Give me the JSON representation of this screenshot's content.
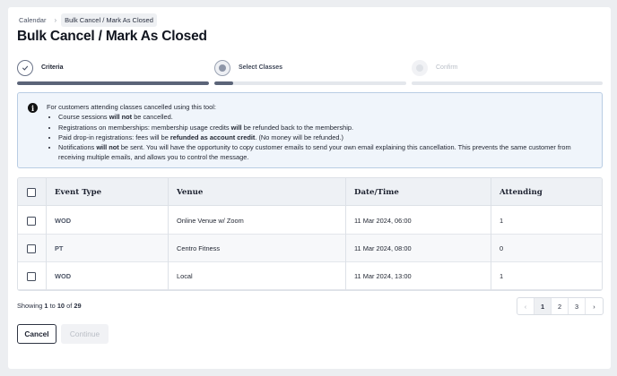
{
  "breadcrumb": {
    "parent": "Calendar",
    "current": "Bulk Cancel / Mark As Closed"
  },
  "page": {
    "title": "Bulk Cancel / Mark As Closed"
  },
  "stepper": {
    "steps": [
      {
        "label": "Criteria",
        "state": "complete"
      },
      {
        "label": "Select Classes",
        "state": "current"
      },
      {
        "label": "Confirm",
        "state": "upcoming"
      }
    ],
    "progress": [
      1.0,
      0.1,
      0.0
    ]
  },
  "info": {
    "icon": "info-icon",
    "intro": "For customers attending classes cancelled using this tool:",
    "b1_a": "Course sessions ",
    "b1_b": "will not",
    "b1_c": " be cancelled.",
    "b2_a": "Registrations on memberships: membership usage credits ",
    "b2_b": "will",
    "b2_c": " be refunded back to the membership.",
    "b3_a": "Paid drop-in registrations: fees will be ",
    "b3_b": "refunded as account credit",
    "b3_c": ". (No money will be refunded.)",
    "b4_a": "Notifications ",
    "b4_b": "will not",
    "b4_c": " be sent. You will have the opportunity to copy customer emails to send your own email explaining this cancellation. This prevents the same customer from receiving multiple emails, and allows you to control the message."
  },
  "table": {
    "headers": {
      "event_type": "Event Type",
      "venue": "Venue",
      "datetime": "Date/Time",
      "attending": "Attending"
    },
    "rows": [
      {
        "event_type": "WOD",
        "venue": "Online Venue w/ Zoom",
        "datetime": "11 Mar 2024, 06:00",
        "attending": "1"
      },
      {
        "event_type": "PT",
        "venue": "Centro Fitness",
        "datetime": "11 Mar 2024, 08:00",
        "attending": "0"
      },
      {
        "event_type": "WOD",
        "venue": "Local",
        "datetime": "11 Mar 2024, 13:00",
        "attending": "1"
      }
    ]
  },
  "pagination": {
    "showing_prefix": "Showing ",
    "from": "1",
    "to_word": " to ",
    "to": "10",
    "of_word": " of ",
    "total": "29",
    "pages": [
      "1",
      "2",
      "3"
    ],
    "prev": "‹",
    "next": "›"
  },
  "actions": {
    "cancel": "Cancel",
    "continue": "Continue"
  },
  "colors": {
    "accent": "#5b6478",
    "info_bg": "#f0f5fb",
    "info_border": "#b9cde4"
  }
}
